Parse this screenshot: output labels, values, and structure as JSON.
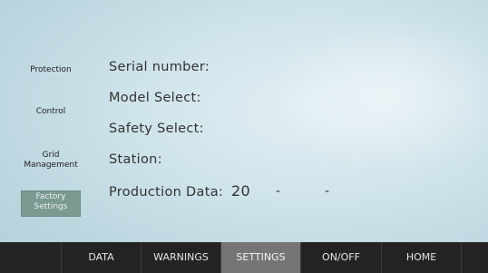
{
  "sidebar": {
    "items": [
      {
        "label": "Protection"
      },
      {
        "label": "Control"
      },
      {
        "label": "Grid\nManagement"
      },
      {
        "label": "Factory\nSettings",
        "active": true
      }
    ]
  },
  "fields": {
    "serial_number": {
      "label": "Serial number:"
    },
    "model_select": {
      "label": "Model Select:"
    },
    "safety_select": {
      "label": "Safety Select:"
    },
    "station": {
      "label": "Station:"
    },
    "production_data": {
      "label": "Production Data:",
      "value": "20",
      "sep1": "-",
      "sep2": "-"
    }
  },
  "navbar": {
    "items": [
      {
        "label": "DATA"
      },
      {
        "label": "WARNINGS"
      },
      {
        "label": "SETTINGS",
        "active": true
      },
      {
        "label": "ON/OFF"
      },
      {
        "label": "HOME"
      }
    ]
  },
  "colors": {
    "active_side_bg": "#7a9a92",
    "active_nav_bg": "#757575",
    "navbar_bg": "#232323"
  }
}
